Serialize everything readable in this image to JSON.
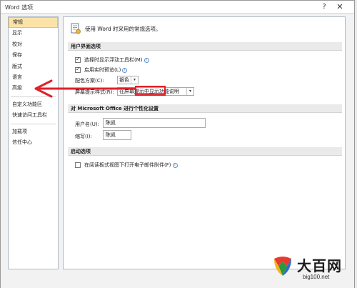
{
  "window": {
    "title": "Word 选项",
    "help": "?",
    "close": "✕"
  },
  "sidebar": {
    "items": [
      {
        "label": "常规"
      },
      {
        "label": "显示"
      },
      {
        "label": "校对"
      },
      {
        "label": "保存"
      },
      {
        "label": "版式"
      },
      {
        "label": "语言"
      },
      {
        "label": "高级"
      },
      {
        "label": "自定义功能区"
      },
      {
        "label": "快速访问工具栏"
      },
      {
        "label": "加载项"
      },
      {
        "label": "信任中心"
      }
    ]
  },
  "main": {
    "header": "使用 Word 时采用的常规选项。",
    "ui_section": {
      "title": "用户界面选项",
      "option1": "选择时显示浮动工具栏(M)",
      "option2": "启用实时预览(L)",
      "color_label": "配色方案(C):",
      "color_value": "银色",
      "tooltip_label": "屏幕提示样式(R):",
      "tooltip_value": "在屏幕提示中显示功能说明"
    },
    "personal_section": {
      "title": "对 Microsoft Office 进行个性化设置",
      "username_label": "用户名(U):",
      "username_value": "陈凯",
      "initials_label": "缩写(I):",
      "initials_value": "陈凯"
    },
    "startup_section": {
      "title": "启动选项",
      "option": "在阅读板式视图下打开电子邮件附件(F)"
    }
  },
  "watermark": {
    "title": "大百网",
    "url": "big100.net"
  },
  "colors": {
    "annotation": "#e0202a",
    "selected_bg": "#fbe3a8"
  }
}
